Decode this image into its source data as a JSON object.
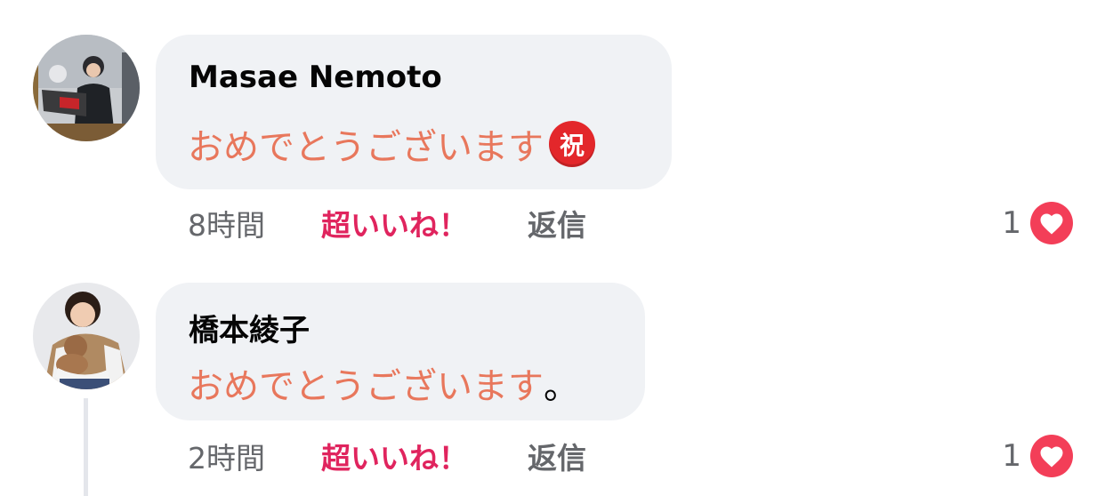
{
  "comments": [
    {
      "author": "Masae Nemoto",
      "message": "おめでとうございます",
      "badge": "祝",
      "time": "8時間",
      "like_label": "超いいね！",
      "reply_label": "返信",
      "reaction_count": "1",
      "reaction_icon": "heart-icon"
    },
    {
      "author": "橋本綾子",
      "message": "おめでとうございます",
      "message_suffix": "。",
      "time": "2時間",
      "like_label": "超いいね！",
      "reply_label": "返信",
      "reaction_count": "1",
      "reaction_icon": "heart-icon"
    }
  ],
  "colors": {
    "bubble_bg": "#f0f2f5",
    "message_text": "#e8775c",
    "super_like": "#e0245e",
    "meta_text": "#65676b",
    "heart_reaction": "#f33e58",
    "iwai_badge": "#e3272b"
  }
}
